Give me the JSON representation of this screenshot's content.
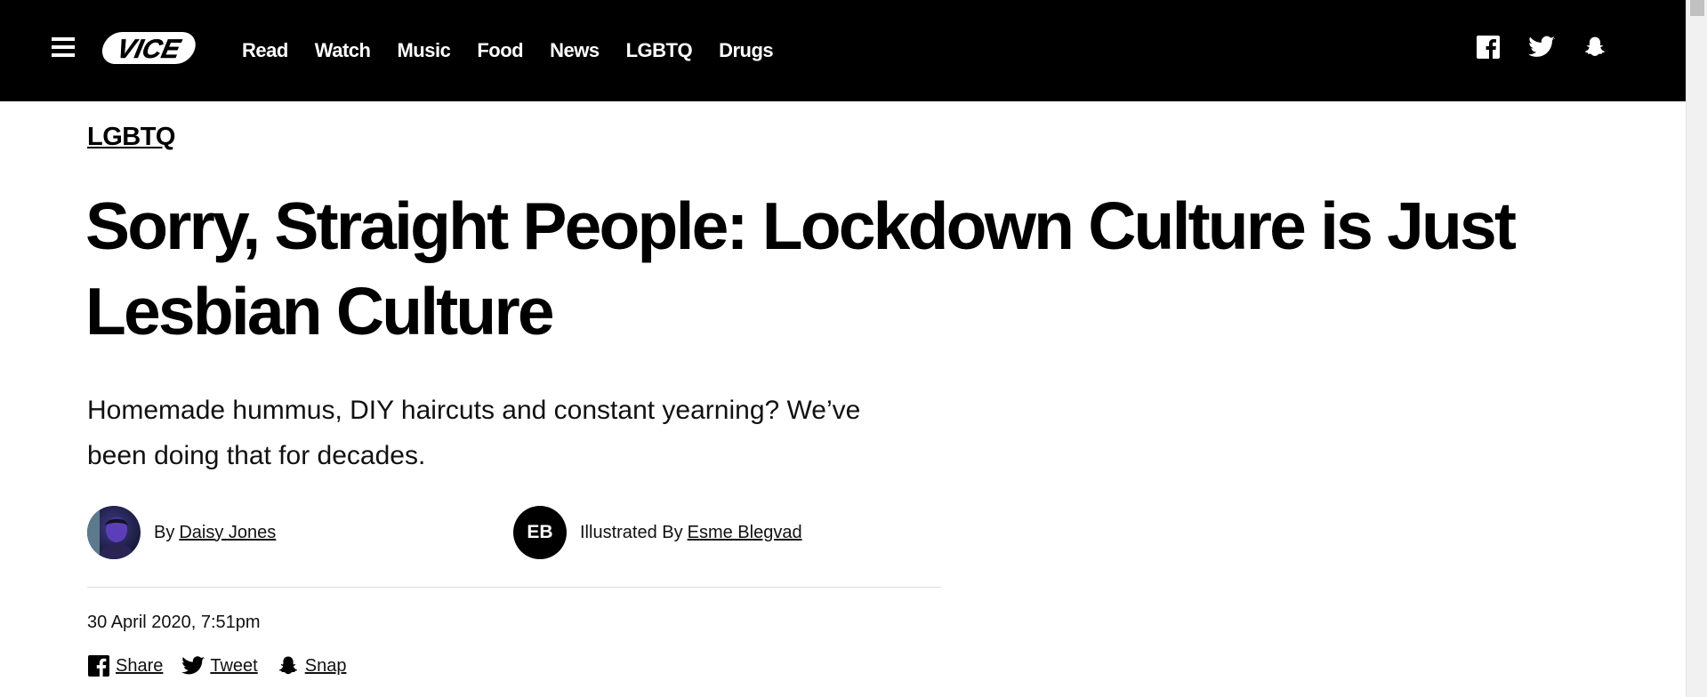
{
  "header": {
    "logo_text": "VICE",
    "nav": [
      "Read",
      "Watch",
      "Music",
      "Food",
      "News",
      "LGBTQ",
      "Drugs"
    ],
    "social_icons": [
      "facebook-icon",
      "twitter-icon",
      "snapchat-icon"
    ]
  },
  "article": {
    "section": "LGBTQ",
    "headline": "Sorry, Straight People: Lockdown Culture is Just Lesbian Culture",
    "dek": "Homemade hummus, DIY haircuts and constant yearning? We’ve been doing that for decades.",
    "author": {
      "prefix": "By",
      "name": "Daisy Jones"
    },
    "illustrator": {
      "initials": "EB",
      "prefix": "Illustrated By",
      "name": "Esme Blegvad"
    },
    "date": "30 April 2020, 7:51pm",
    "share": {
      "facebook": "Share",
      "twitter": "Tweet",
      "snapchat": "Snap"
    }
  },
  "colors": {
    "topbar": "#000000",
    "text": "#000000",
    "divider": "#dcdcdc"
  }
}
